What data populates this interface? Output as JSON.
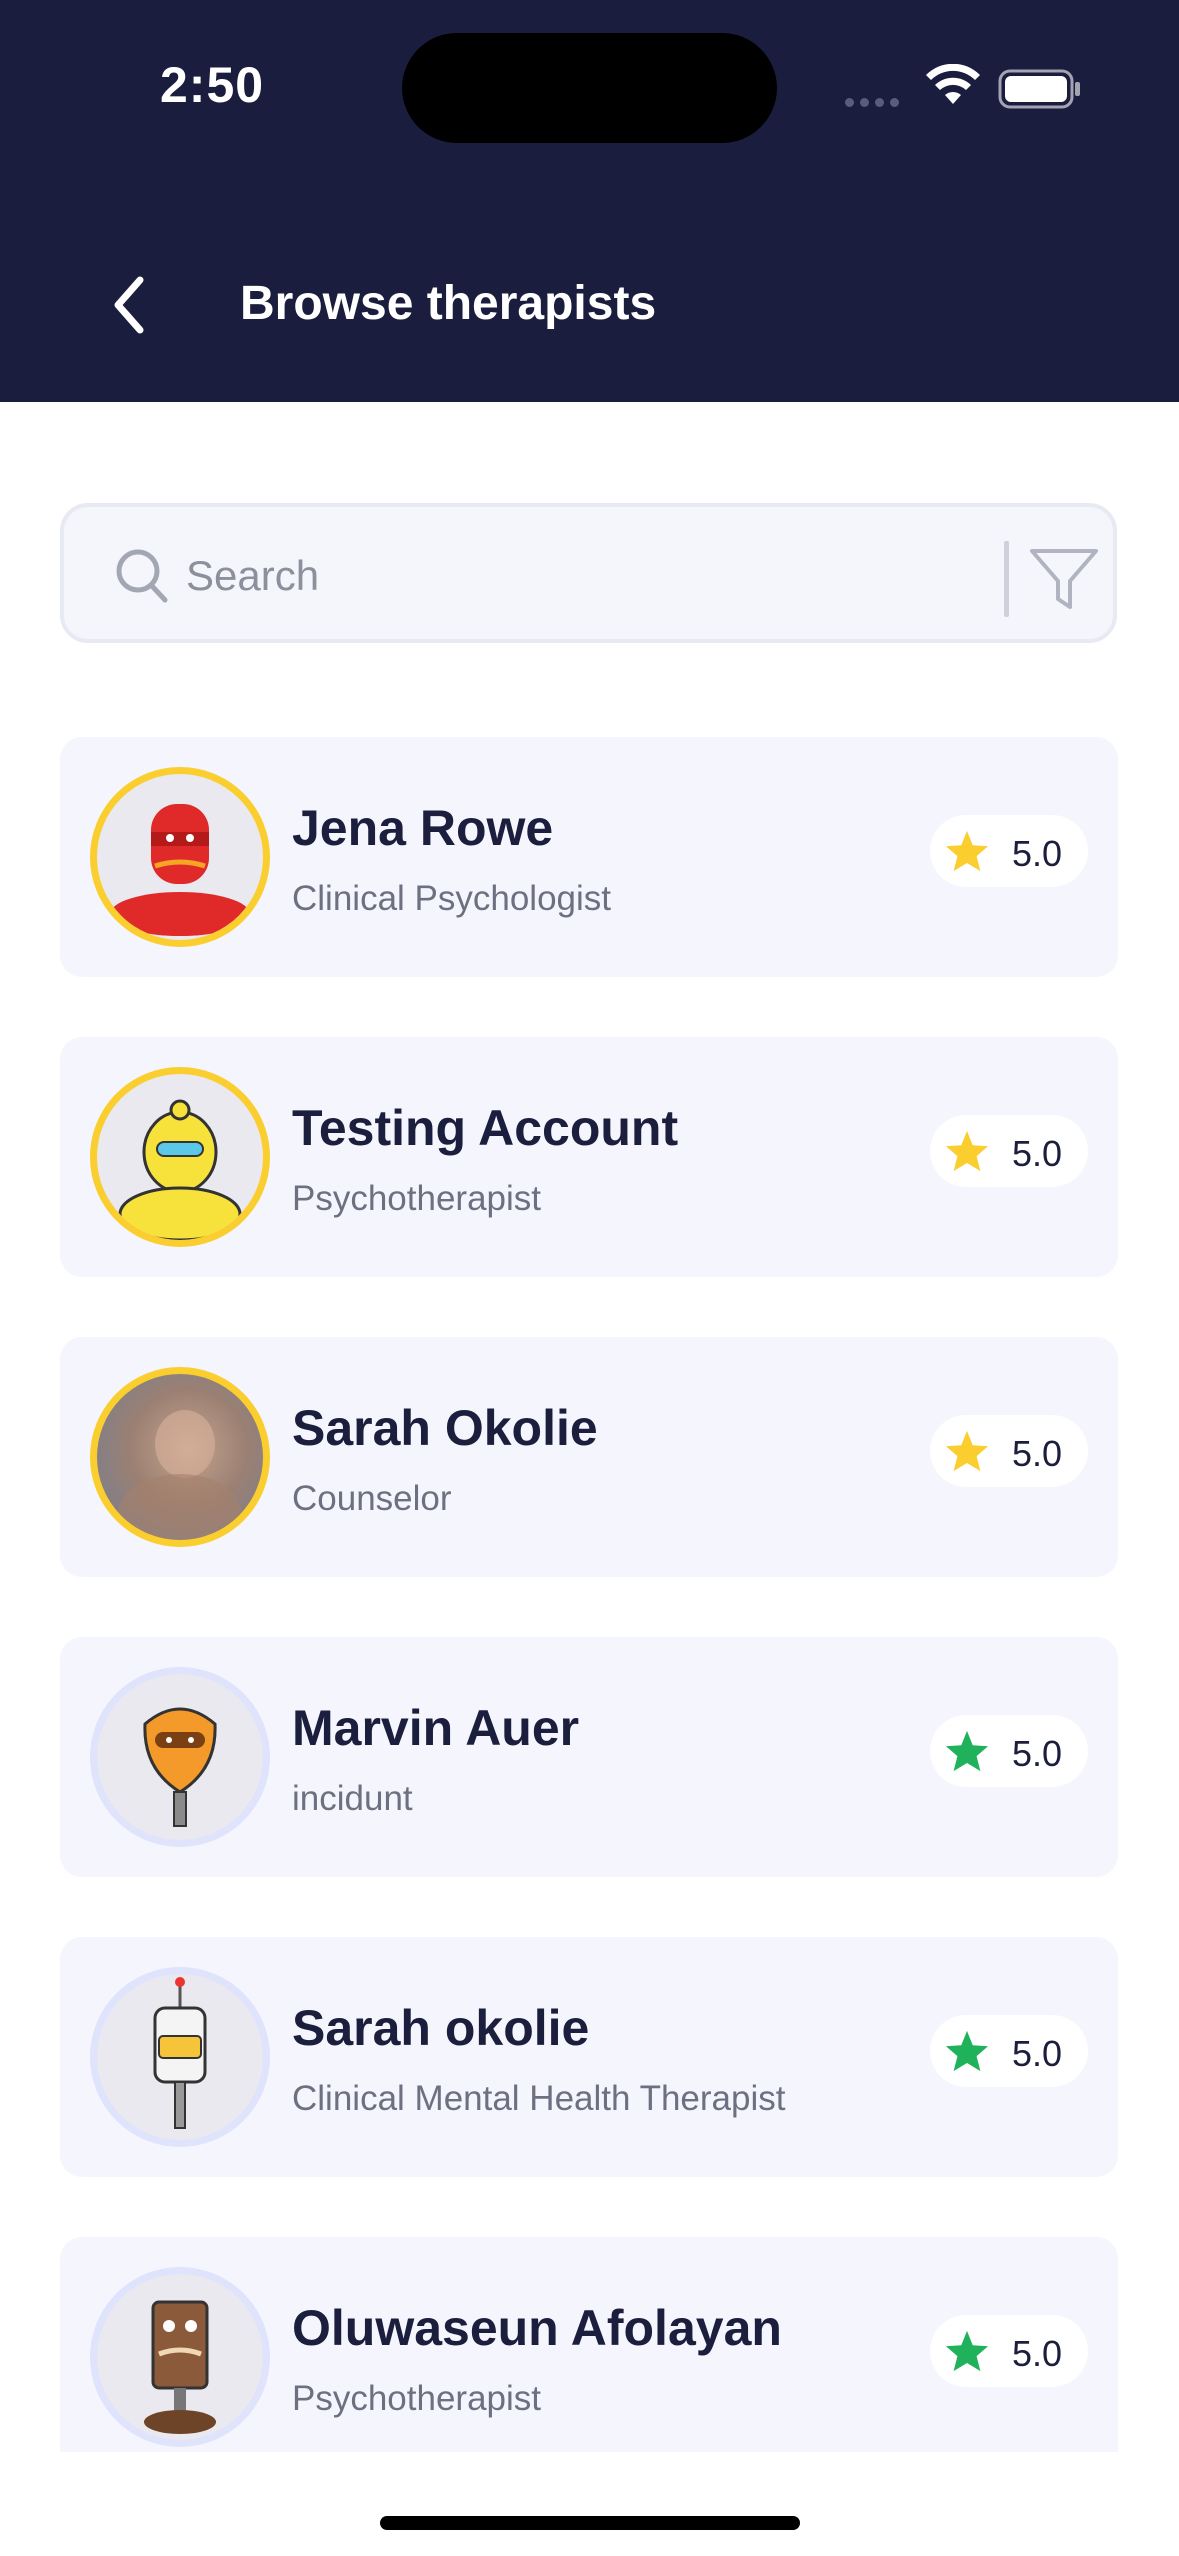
{
  "status_bar": {
    "time": "2:50"
  },
  "header": {
    "title": "Browse therapists"
  },
  "search": {
    "placeholder": "Search"
  },
  "therapists": [
    {
      "name": "Jena Rowe",
      "role": "Clinical Psychologist",
      "rating": "5.0",
      "star_color": "#f9ce2e",
      "avatar": "red-robot-avatar"
    },
    {
      "name": "Testing Account",
      "role": "Psychotherapist",
      "rating": "5.0",
      "star_color": "#f9ce2e",
      "avatar": "yellow-robot-avatar"
    },
    {
      "name": "Sarah Okolie",
      "role": "Counselor",
      "rating": "5.0",
      "star_color": "#f9ce2e",
      "avatar": "blurred-photo-avatar"
    },
    {
      "name": "Marvin Auer",
      "role": "incidunt",
      "rating": "5.0",
      "star_color": "#1fb25a",
      "avatar": "orange-robot-avatar"
    },
    {
      "name": "Sarah okolie",
      "role": "Clinical Mental Health Therapist",
      "rating": "5.0",
      "star_color": "#1fb25a",
      "avatar": "white-robot-avatar"
    },
    {
      "name": "Oluwaseun Afolayan",
      "role": "Psychotherapist",
      "rating": "5.0",
      "star_color": "#1fb25a",
      "avatar": "brown-robot-avatar"
    }
  ],
  "colors": {
    "header_bg": "#1b1d3e",
    "card_bg": "#f5f6fd",
    "gold_ring": "#f9ce2e",
    "star_gold": "#f9ce2e",
    "star_green": "#1fb25a"
  }
}
